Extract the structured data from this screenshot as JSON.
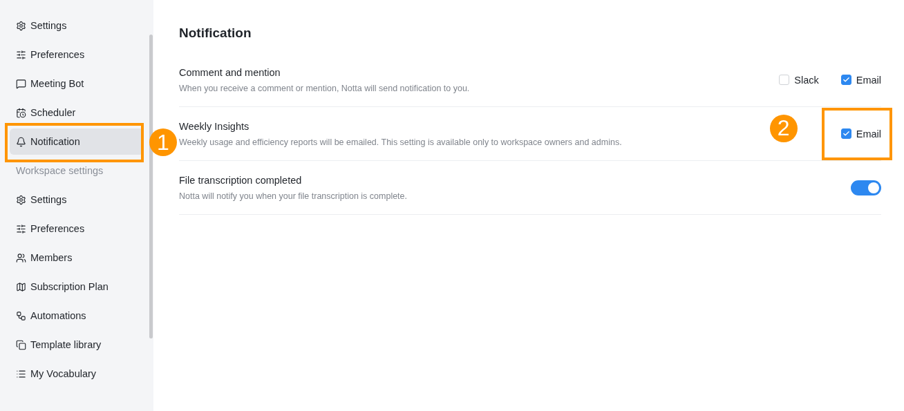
{
  "sidebar": {
    "personal_items": [
      {
        "label": "Settings",
        "selected": false
      },
      {
        "label": "Preferences",
        "selected": false
      },
      {
        "label": "Meeting Bot",
        "selected": false
      },
      {
        "label": "Scheduler",
        "selected": false
      },
      {
        "label": "Notification",
        "selected": true,
        "callout": "1"
      }
    ],
    "section_header": "Workspace settings",
    "workspace_items": [
      {
        "label": "Settings",
        "selected": false
      },
      {
        "label": "Preferences",
        "selected": false
      },
      {
        "label": "Members",
        "selected": false
      },
      {
        "label": "Subscription Plan",
        "selected": false
      },
      {
        "label": "Automations",
        "selected": false
      },
      {
        "label": "Template library",
        "selected": false
      },
      {
        "label": "My Vocabulary",
        "selected": false
      }
    ]
  },
  "main": {
    "title": "Notification",
    "settings": [
      {
        "kind": "checkboxes",
        "title": "Comment and mention",
        "description": "When you receive a comment or mention, Notta will send notification to you.",
        "options": [
          {
            "label": "Slack",
            "checked": false
          },
          {
            "label": "Email",
            "checked": true
          }
        ]
      },
      {
        "kind": "checkboxes",
        "title": "Weekly Insights",
        "description": "Weekly usage and efficiency reports will be emailed. This setting is available only to workspace owners and admins.",
        "callout": "2",
        "options": [
          {
            "label": "Email",
            "checked": true
          }
        ]
      },
      {
        "kind": "toggle",
        "title": "File transcription completed",
        "description": "Notta will notify you when your file transcription is complete.",
        "on": true
      }
    ]
  }
}
